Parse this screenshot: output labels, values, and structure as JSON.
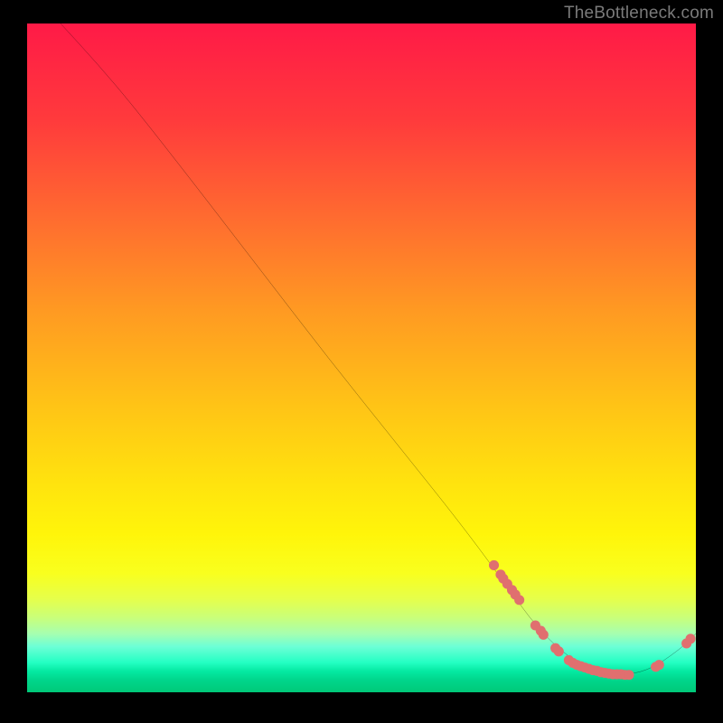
{
  "attribution": "TheBottleneck.com",
  "chart_data": {
    "type": "line",
    "title": "",
    "xlabel": "",
    "ylabel": "",
    "xlim": [
      0,
      100
    ],
    "ylim": [
      0,
      100
    ],
    "curve": [
      {
        "x": 5.0,
        "y": 100.0
      },
      {
        "x": 10.5,
        "y": 94.0
      },
      {
        "x": 16.0,
        "y": 87.5
      },
      {
        "x": 25.0,
        "y": 76.0
      },
      {
        "x": 35.0,
        "y": 63.0
      },
      {
        "x": 45.0,
        "y": 50.0
      },
      {
        "x": 55.0,
        "y": 37.5
      },
      {
        "x": 65.0,
        "y": 25.0
      },
      {
        "x": 72.0,
        "y": 15.5
      },
      {
        "x": 76.0,
        "y": 10.0
      },
      {
        "x": 80.0,
        "y": 6.0
      },
      {
        "x": 83.5,
        "y": 3.8
      },
      {
        "x": 86.5,
        "y": 2.8
      },
      {
        "x": 90.0,
        "y": 2.6
      },
      {
        "x": 93.5,
        "y": 3.6
      },
      {
        "x": 97.0,
        "y": 6.0
      },
      {
        "x": 99.0,
        "y": 7.7
      },
      {
        "x": 100.0,
        "y": 8.8
      }
    ],
    "cluster_points": [
      {
        "x": 69.8,
        "y": 19.0
      },
      {
        "x": 70.8,
        "y": 17.6
      },
      {
        "x": 71.2,
        "y": 17.0
      },
      {
        "x": 71.8,
        "y": 16.2
      },
      {
        "x": 72.5,
        "y": 15.3
      },
      {
        "x": 73.0,
        "y": 14.6
      },
      {
        "x": 73.6,
        "y": 13.8
      },
      {
        "x": 76.0,
        "y": 10.0
      },
      {
        "x": 76.8,
        "y": 9.2
      },
      {
        "x": 77.2,
        "y": 8.6
      },
      {
        "x": 79.0,
        "y": 6.6
      },
      {
        "x": 79.5,
        "y": 6.1
      },
      {
        "x": 81.0,
        "y": 4.8
      },
      {
        "x": 81.6,
        "y": 4.4
      },
      {
        "x": 82.2,
        "y": 4.1
      },
      {
        "x": 82.8,
        "y": 3.9
      },
      {
        "x": 83.4,
        "y": 3.7
      },
      {
        "x": 84.0,
        "y": 3.5
      },
      {
        "x": 84.6,
        "y": 3.3
      },
      {
        "x": 85.2,
        "y": 3.2
      },
      {
        "x": 85.8,
        "y": 3.0
      },
      {
        "x": 86.4,
        "y": 2.9
      },
      {
        "x": 87.0,
        "y": 2.8
      },
      {
        "x": 87.6,
        "y": 2.7
      },
      {
        "x": 88.2,
        "y": 2.7
      },
      {
        "x": 88.8,
        "y": 2.7
      },
      {
        "x": 89.4,
        "y": 2.6
      },
      {
        "x": 90.0,
        "y": 2.6
      },
      {
        "x": 94.0,
        "y": 3.8
      },
      {
        "x": 94.5,
        "y": 4.1
      },
      {
        "x": 98.6,
        "y": 7.3
      },
      {
        "x": 99.2,
        "y": 8.0
      }
    ],
    "colors": {
      "curve": "#000000",
      "points": "#e06f6f",
      "gradient_top": "#ff1a47",
      "gradient_bottom": "#00c878"
    }
  }
}
